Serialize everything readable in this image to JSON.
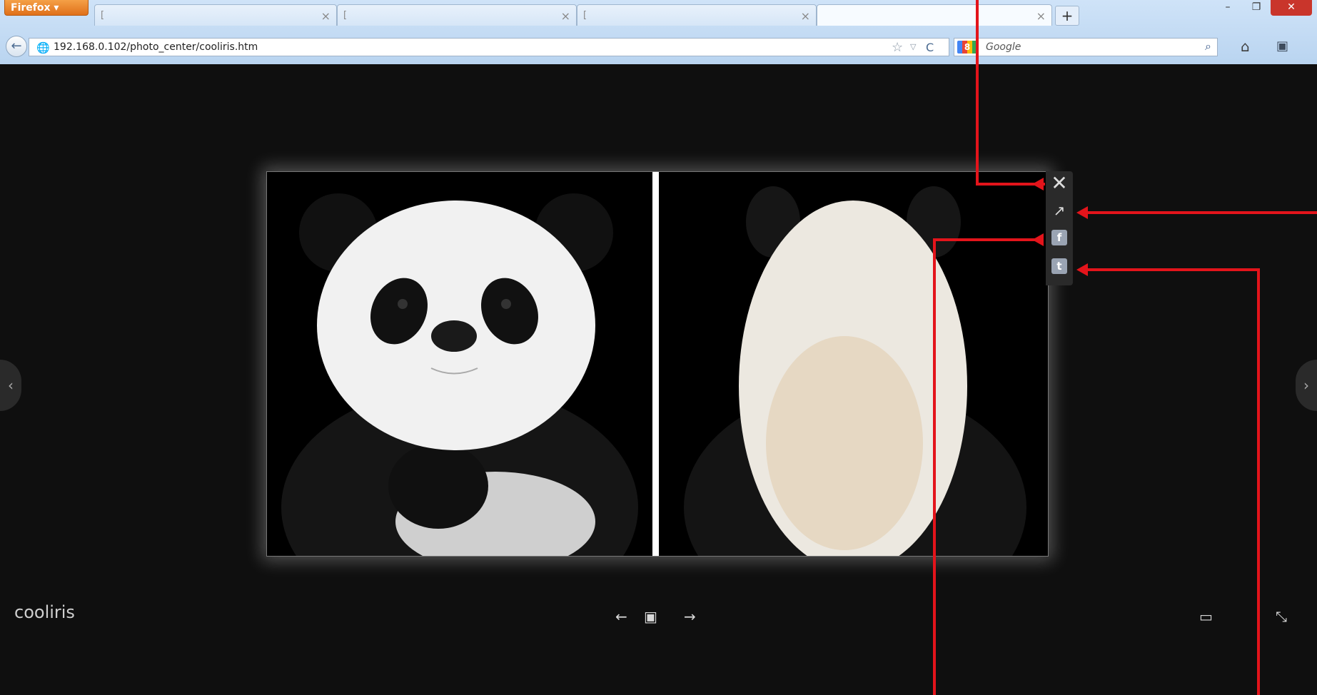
{
  "browser": {
    "menu_label": "Firefox ▾",
    "tabs": [
      {
        "label": "[",
        "close": "×"
      },
      {
        "label": "[",
        "close": "×"
      },
      {
        "label": "[",
        "close": "×"
      },
      {
        "label": "",
        "close": "×"
      }
    ],
    "new_tab": "+",
    "window_controls": {
      "minimize": "–",
      "restore": "❐",
      "close": "✕"
    },
    "back": "←",
    "globe": "🌐",
    "url": "192.168.0.102/photo_center/cooliris.htm",
    "star": "☆",
    "dropdown": "▽",
    "reload": "C",
    "google_logo": "8",
    "search_placeholder": "Google",
    "search_icon": "⌕",
    "home_icon": "⌂",
    "bookmarks_icon": "▣"
  },
  "viewer": {
    "brand": "cooliris",
    "tools": {
      "close": "✕",
      "open_external": "↗",
      "facebook": "f",
      "twitter": "t"
    },
    "prev_arrow": "‹",
    "next_arrow": "›",
    "controls": {
      "prev": "←",
      "slideshow": "▣",
      "next": "→",
      "screen": "▭",
      "fullscreen": "⤡"
    }
  },
  "colors": {
    "annotation": "#e3141b",
    "background": "#0f0f0f",
    "titlebar": "#bcd6f1",
    "firefox": "#e8801f"
  }
}
